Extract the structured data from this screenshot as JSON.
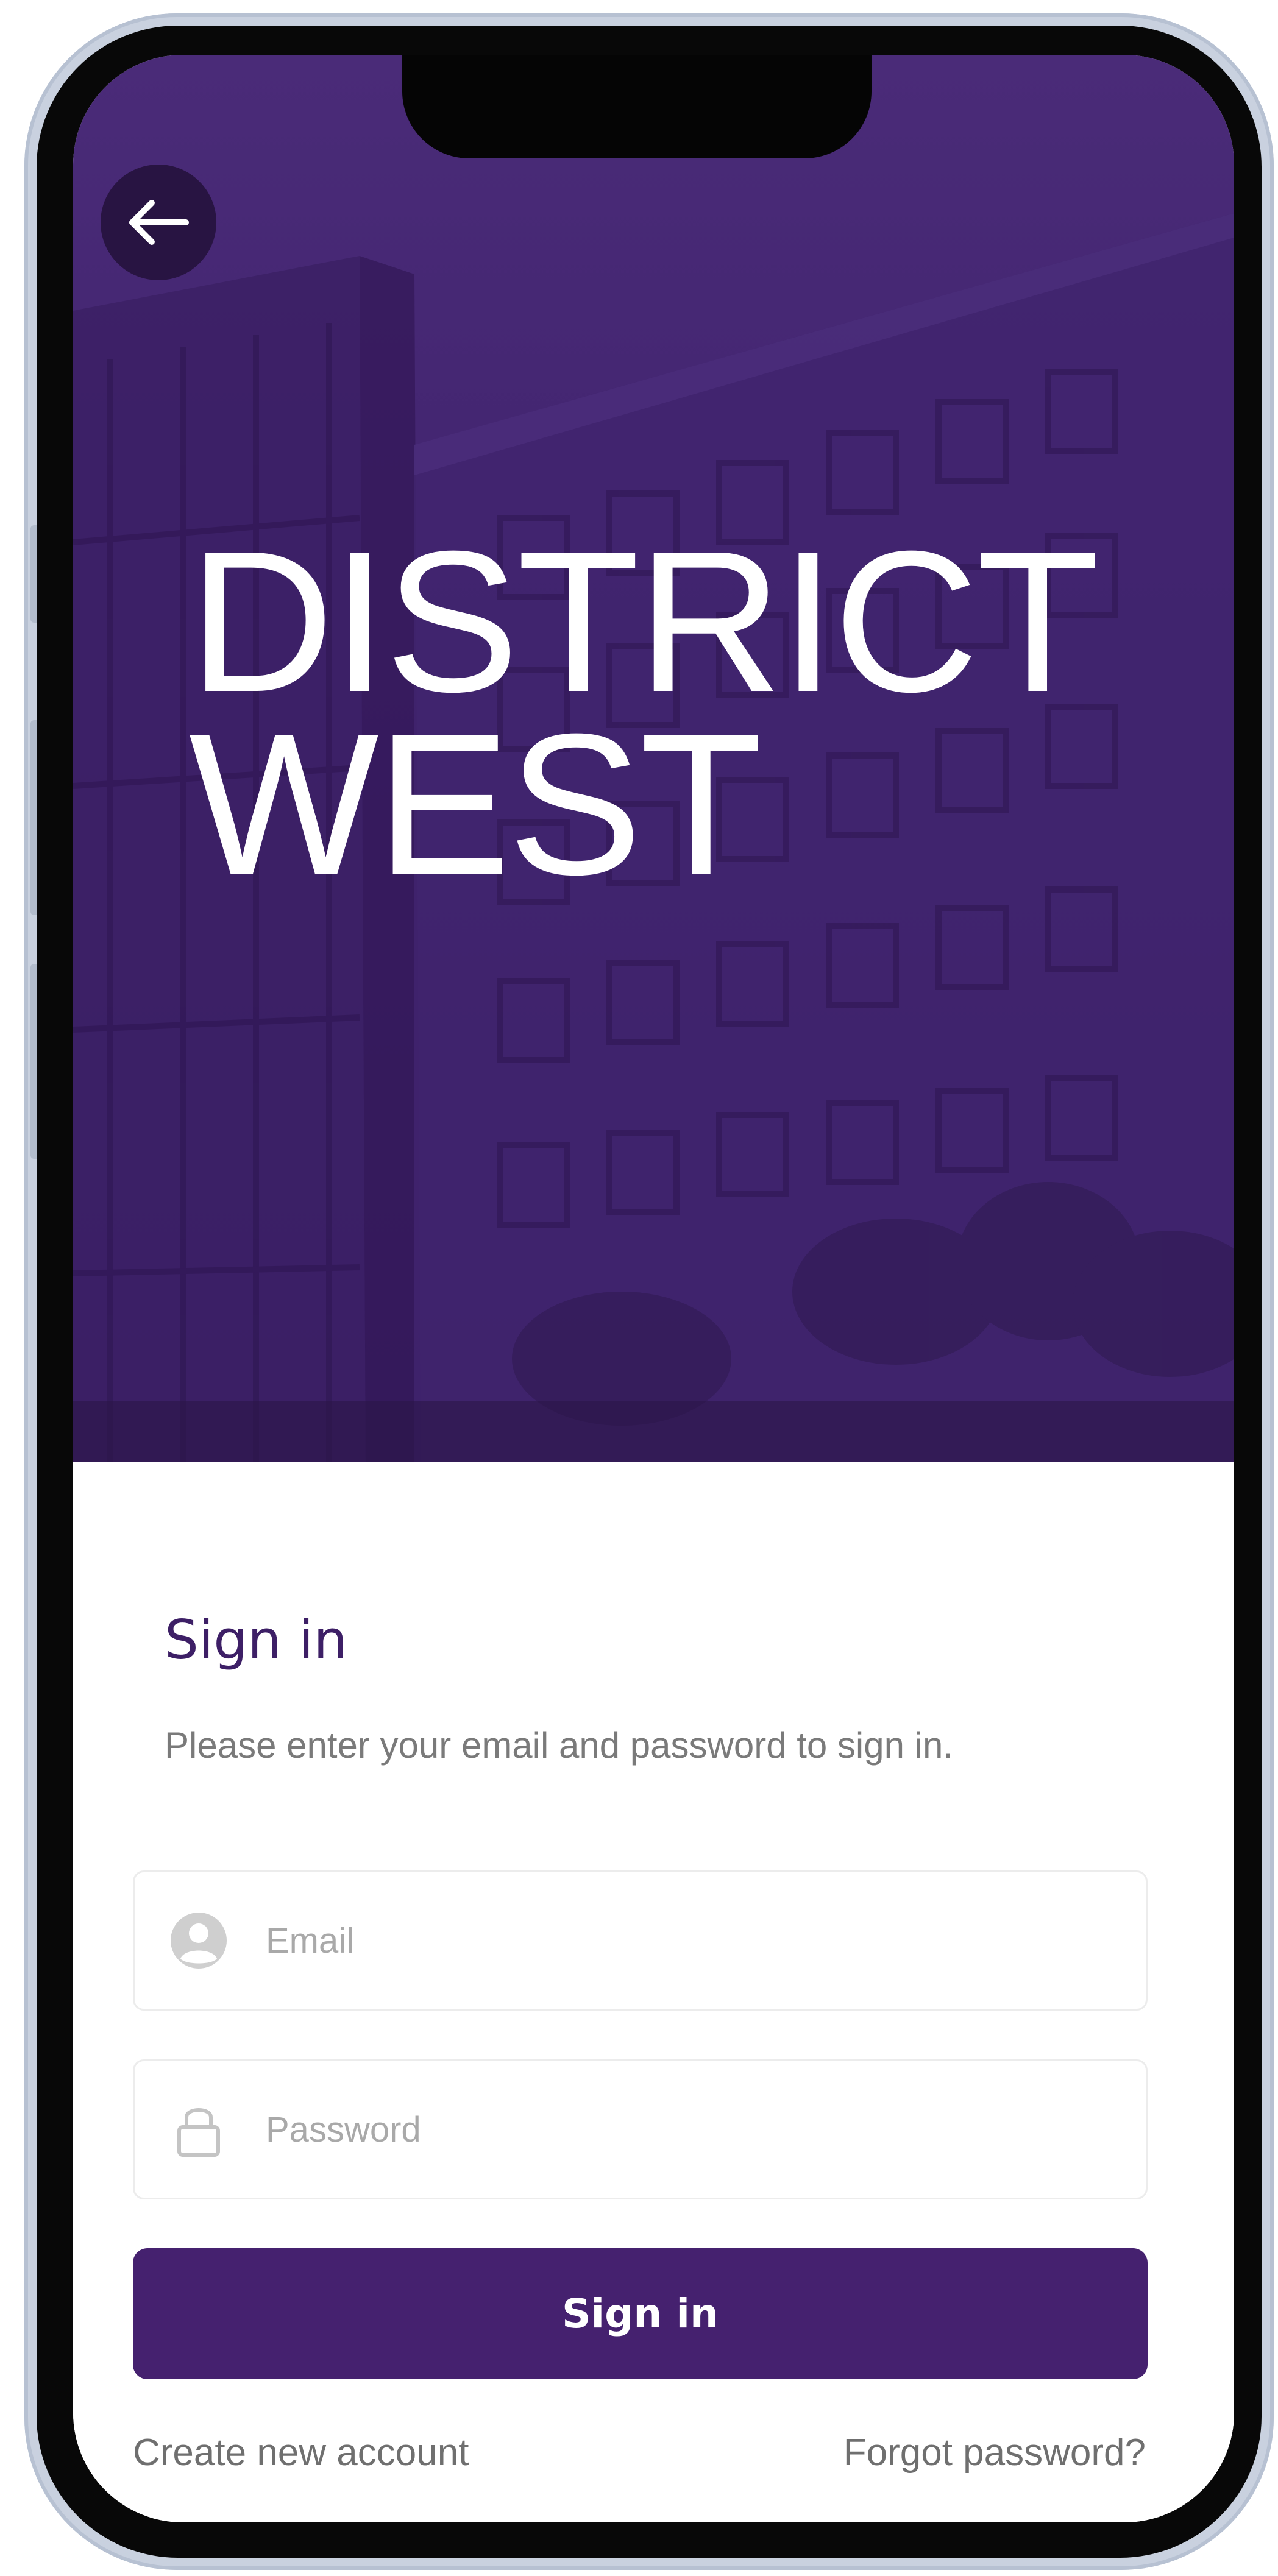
{
  "hero": {
    "title_line1": "DISTRICT",
    "title_line2": "WEST",
    "back_icon": "arrow-left-icon",
    "background_color": "#3f226d"
  },
  "signin": {
    "heading": "Sign in",
    "subtitle": "Please enter your email and password to sign in.",
    "email": {
      "placeholder": "Email",
      "value": "",
      "icon": "user-circle-icon"
    },
    "password": {
      "placeholder": "Password",
      "value": "",
      "icon": "lock-icon"
    },
    "submit_label": "Sign in",
    "create_account_label": "Create new account",
    "forgot_password_label": "Forgot password?"
  },
  "colors": {
    "brand_purple": "#45216f",
    "heading_purple": "#3d1f66",
    "muted_text": "#7a7a7a"
  }
}
